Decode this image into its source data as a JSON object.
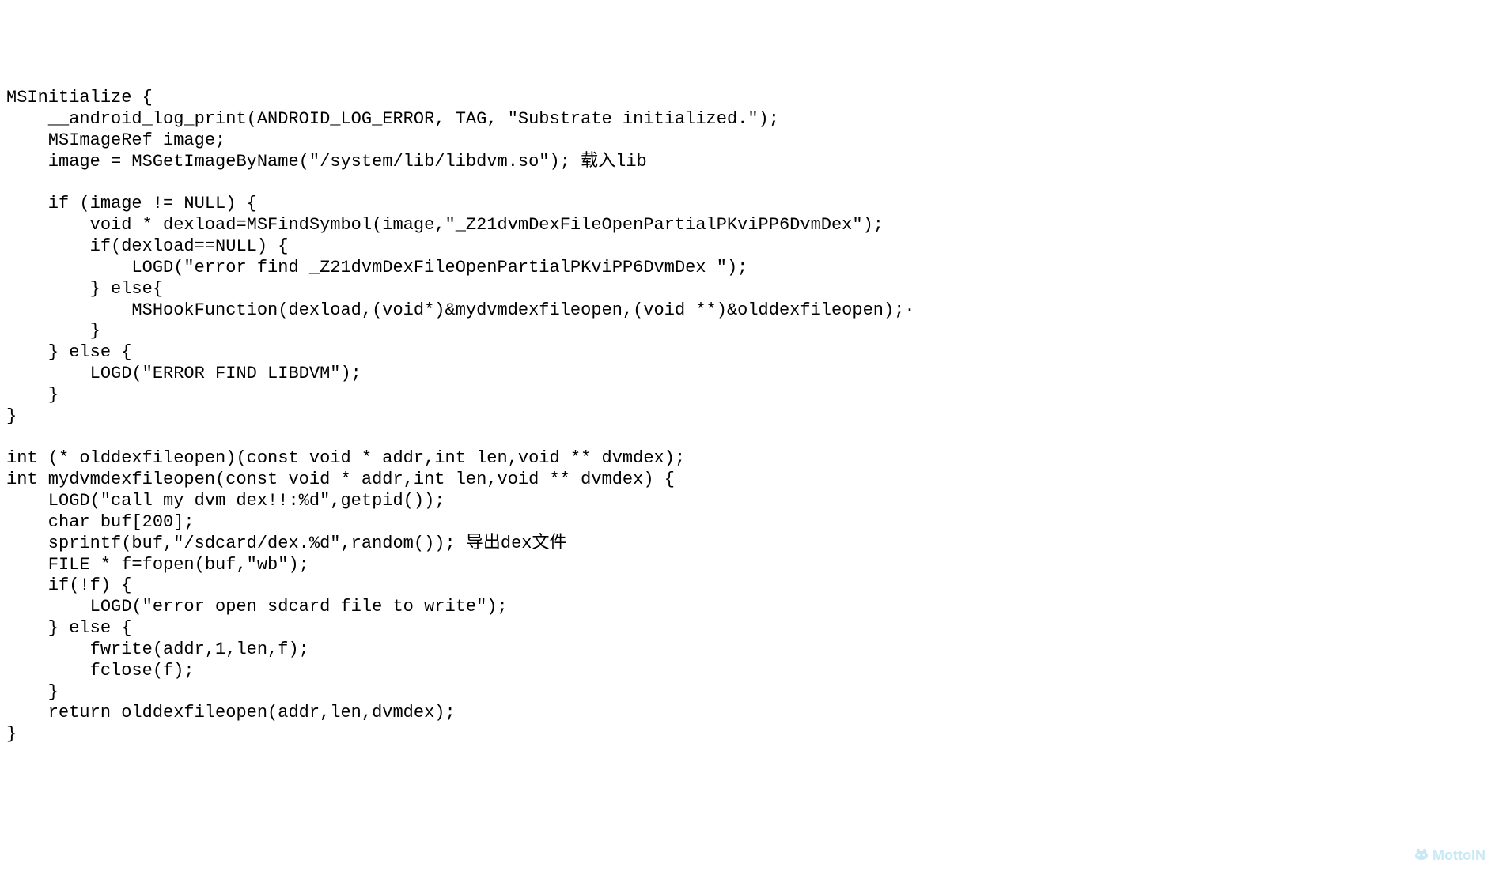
{
  "code": {
    "lines": [
      "MSInitialize {",
      "    __android_log_print(ANDROID_LOG_ERROR, TAG, \"Substrate initialized.\");",
      "    MSImageRef image;",
      "    image = MSGetImageByName(\"/system/lib/libdvm.so\"); 载入lib",
      "",
      "    if (image != NULL) {",
      "        void * dexload=MSFindSymbol(image,\"_Z21dvmDexFileOpenPartialPKviPP6DvmDex\");",
      "        if(dexload==NULL) {",
      "            LOGD(\"error find _Z21dvmDexFileOpenPartialPKviPP6DvmDex \");",
      "        } else{",
      "            MSHookFunction(dexload,(void*)&mydvmdexfileopen,(void **)&olddexfileopen);·",
      "        }",
      "    } else {",
      "        LOGD(\"ERROR FIND LIBDVM\");",
      "    }",
      "}",
      "",
      "int (* olddexfileopen)(const void * addr,int len,void ** dvmdex);",
      "int mydvmdexfileopen(const void * addr,int len,void ** dvmdex) {",
      "    LOGD(\"call my dvm dex!!:%d\",getpid());",
      "    char buf[200];",
      "    sprintf(buf,\"/sdcard/dex.%d\",random()); 导出dex文件",
      "    FILE * f=fopen(buf,\"wb\");",
      "    if(!f) {",
      "        LOGD(\"error open sdcard file to write\");",
      "    } else {",
      "        fwrite(addr,1,len,f);",
      "        fclose(f);",
      "    }",
      "    return olddexfileopen(addr,len,dvmdex);",
      "}"
    ]
  },
  "watermark": {
    "text": "MottoIN"
  }
}
